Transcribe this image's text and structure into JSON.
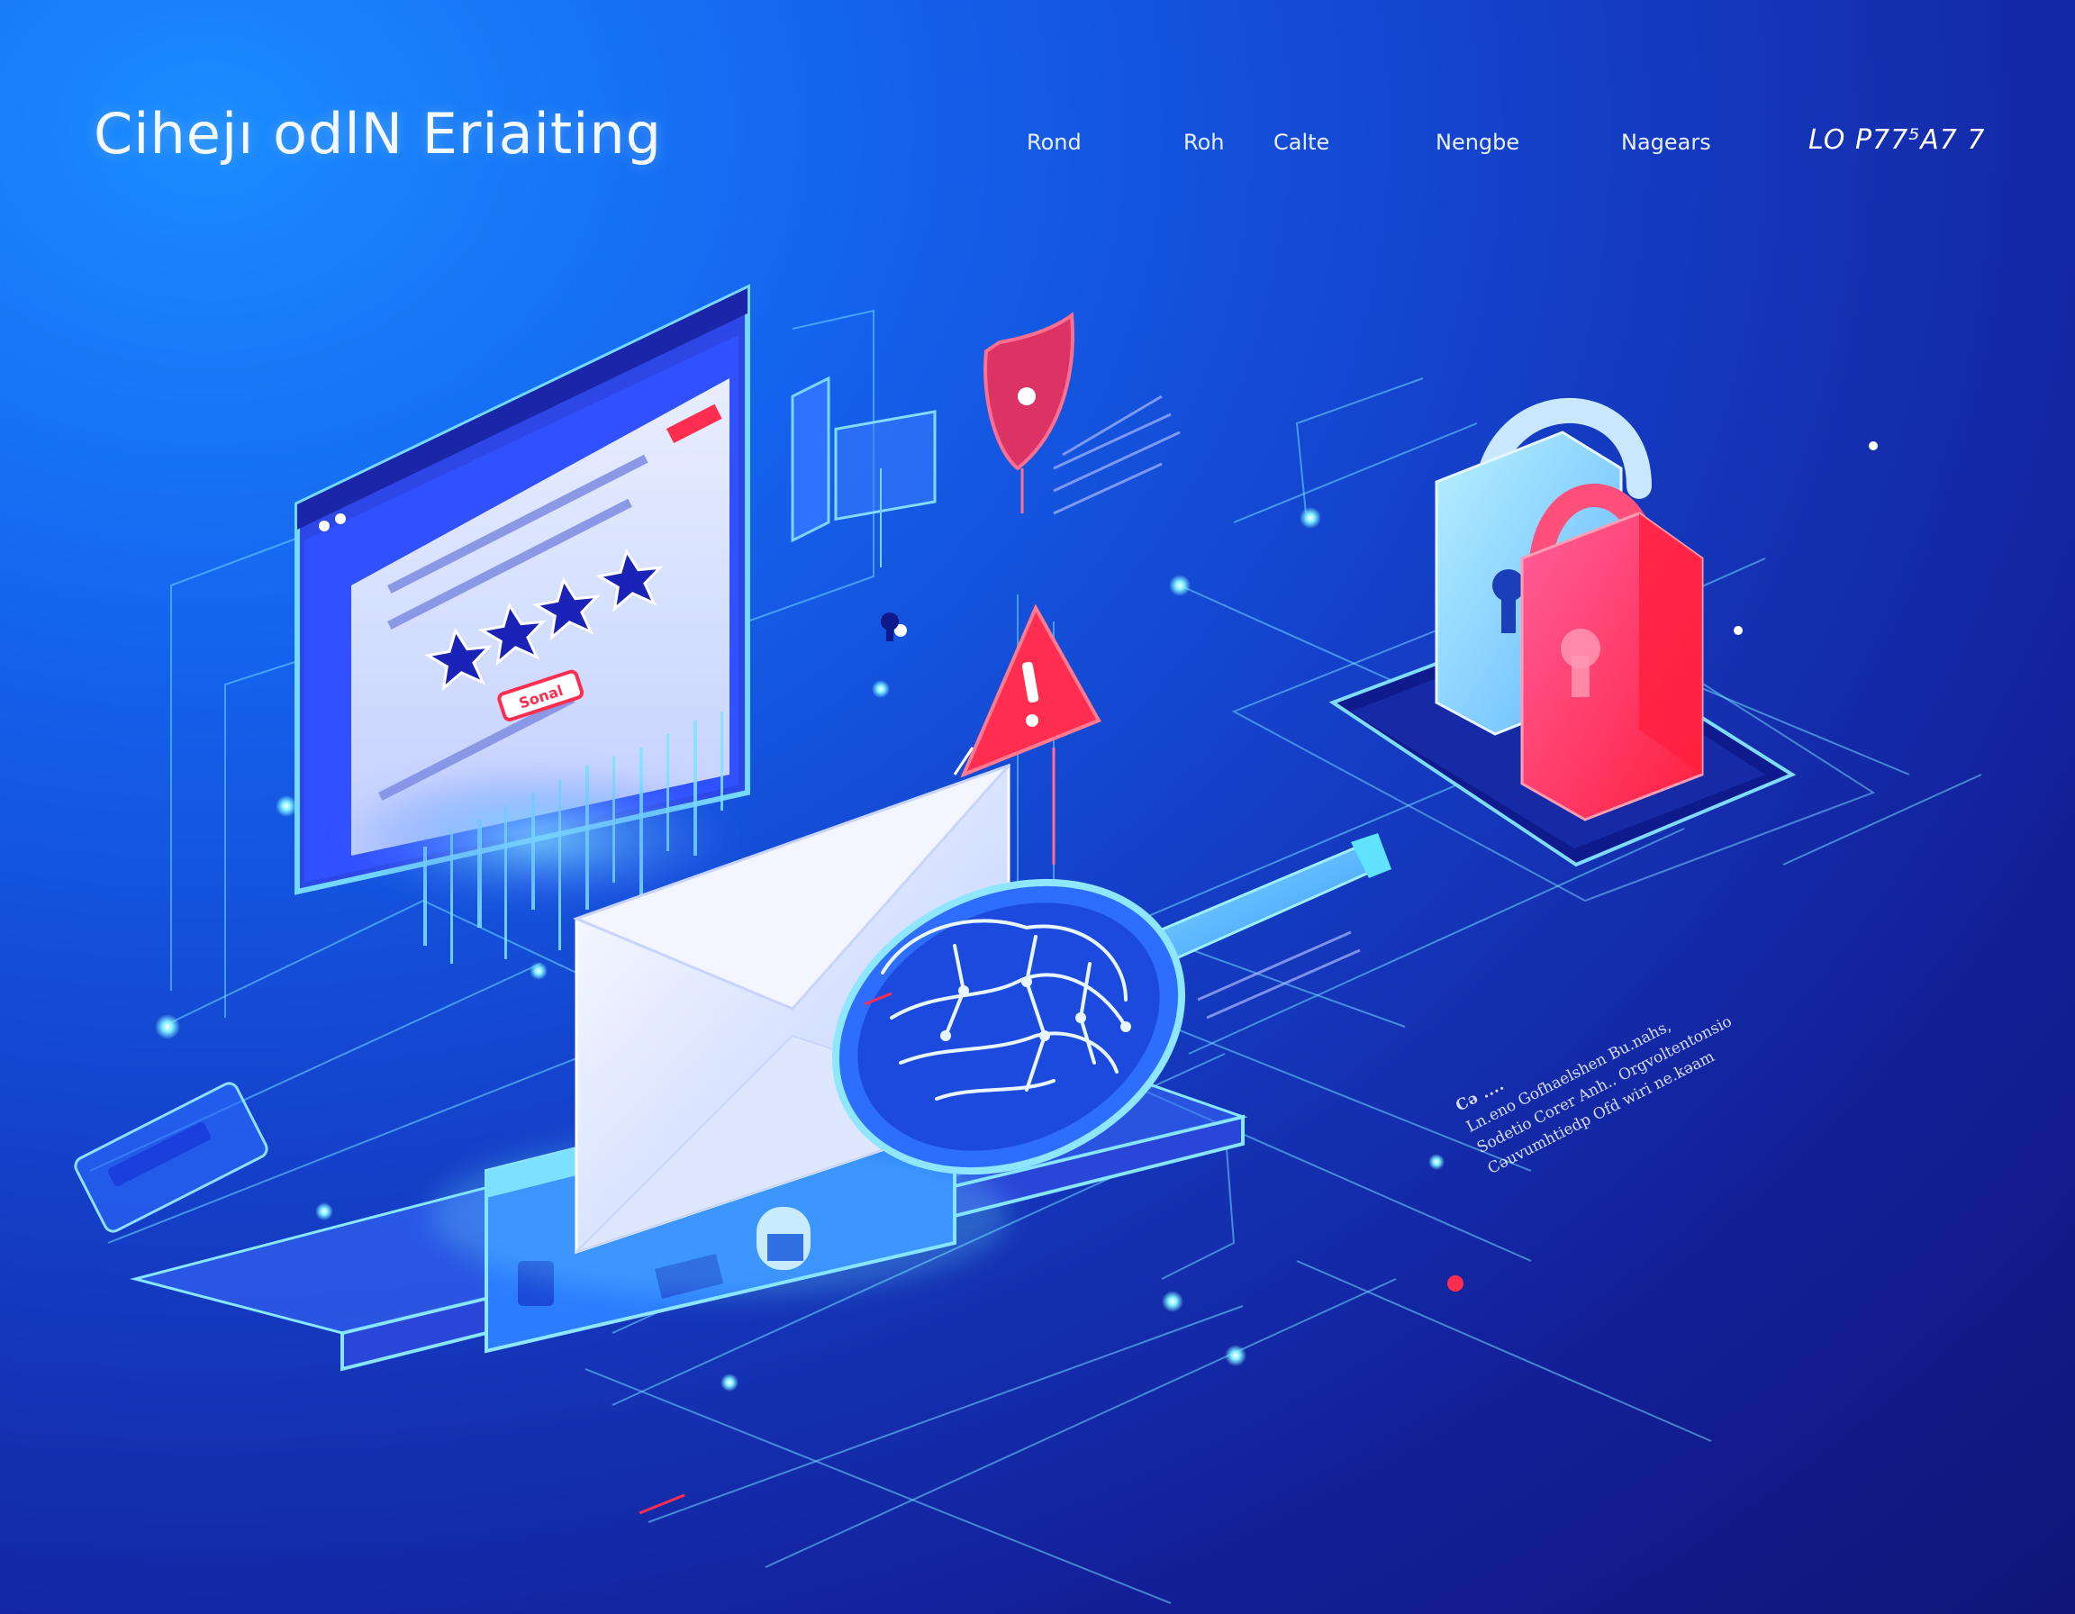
{
  "header": {
    "brand_title": "Cihejı odlN Eriaiting",
    "nav": [
      {
        "label": "Rond"
      },
      {
        "label": "Roh"
      },
      {
        "label": "Calte"
      },
      {
        "label": "Nengbe"
      },
      {
        "label": "Nagears"
      }
    ],
    "cta_label": "LO P77⁵A7 7"
  },
  "illustration": {
    "monitor": {
      "alert_badge": "Sonal",
      "rating_stars": 4
    },
    "caption": {
      "heading": "Cə ....",
      "lines": [
        "Ln.eno  Gofhaelshen  Bu.nahs,",
        "Sodetio  Corer Anh.. Orgvoltentonsio",
        "Cəuvumhtiedp  Ofd wiri  ne.kəam"
      ]
    }
  },
  "colors": {
    "bg_top": "#1b8cff",
    "bg_bottom": "#0f1677",
    "accent_cyan": "#5fe3ff",
    "accent_red": "#ff2d4f",
    "accent_pink": "#ff3f8a",
    "star_navy": "#1a22b8"
  },
  "icons": {
    "monitor": "monitor-icon",
    "star": "star-icon",
    "shield": "shield-icon",
    "padlock": "padlock-icon",
    "warning": "warning-triangle-icon",
    "envelope": "envelope-icon",
    "magnifier": "magnifying-glass-icon",
    "keyhole": "keyhole-icon"
  }
}
